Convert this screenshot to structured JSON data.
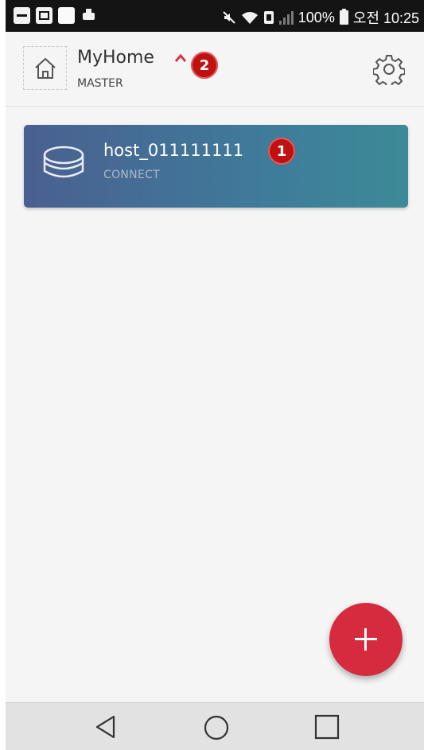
{
  "status_bar": {
    "left_icons": [
      "dash-notification-icon",
      "image-notification-icon",
      "app-notification-icon",
      "print-notification-icon"
    ],
    "right_icons": [
      "mute-icon",
      "wifi-icon",
      "nfc-icon",
      "signal-icon",
      "battery-icon"
    ],
    "battery": "100%",
    "time": "오전 10:25"
  },
  "header": {
    "title": "MyHome",
    "subtitle": "MASTER",
    "badge": "2"
  },
  "host_card": {
    "name": "host_011111111",
    "status": "CONNECT",
    "badge": "1"
  },
  "fab": {
    "icon": "plus-icon"
  },
  "nav": {
    "buttons": [
      "back",
      "home",
      "recents"
    ]
  },
  "colors": {
    "accent": "#d62b3e",
    "card_start": "#4a6090",
    "card_end": "#3c8a98",
    "badge": "#c01010",
    "chevron": "#d0384a"
  }
}
